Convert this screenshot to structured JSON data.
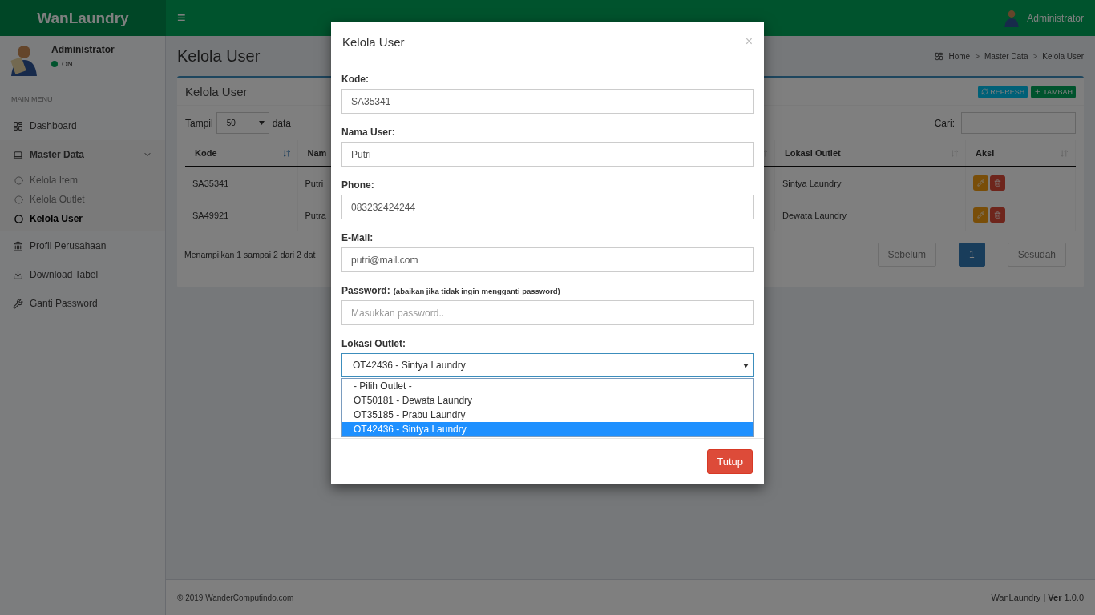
{
  "brand": "WanLaundry",
  "menu_toggle": "≡",
  "user_menu": {
    "name": "Administrator"
  },
  "sidebar": {
    "user": {
      "name": "Administrator",
      "status": "ON",
      "online": true
    },
    "header": "MAIN MENU",
    "items": [
      {
        "label": "Dashboard",
        "kind": "dashboard",
        "selected": false
      },
      {
        "label": "Master Data",
        "kind": "laptop",
        "selected": false,
        "expanded": true,
        "children": [
          {
            "label": "Kelola Item",
            "selected": false
          },
          {
            "label": "Kelola Outlet",
            "selected": false
          },
          {
            "label": "Kelola User",
            "selected": true
          }
        ]
      },
      {
        "label": "Profil Perusahaan",
        "kind": "bank",
        "selected": false
      },
      {
        "label": "Download Tabel",
        "kind": "download",
        "selected": false
      },
      {
        "label": "Ganti Password",
        "kind": "wrench",
        "selected": false
      }
    ]
  },
  "page_title": "Kelola User",
  "breadcrumb": [
    {
      "label": "Home"
    },
    {
      "separator": ">",
      "label": "Master Data"
    },
    {
      "separator": ">",
      "label": "Kelola User"
    }
  ],
  "box": {
    "title": "Kelola User",
    "buttons": [
      {
        "label": "REFRESH",
        "kind": "refresh"
      },
      {
        "label": "TAMBAH",
        "kind": "add"
      }
    ],
    "length": {
      "before": "Tampil",
      "value": "50",
      "after": "data"
    },
    "search": {
      "label": "Cari:"
    },
    "table": {
      "columns": [
        {
          "label": "Kode",
          "sorted": true
        },
        {
          "label": "Nam",
          "sorted": false
        },
        {
          "label": "Lokasi Outlet",
          "sorted": false
        },
        {
          "label": "Aksi",
          "sorted": false
        }
      ],
      "rows": [
        {
          "kode": "SA35341",
          "name": "Putri",
          "outlet": "Sintya Laundry"
        },
        {
          "kode": "SA49921",
          "name": "Putra",
          "outlet": "Dewata Laundry"
        }
      ]
    },
    "info": "Menampilkan 1 sampai 2 dari 2 dat",
    "pagination": [
      {
        "label": "Sebelum",
        "selected": false
      },
      {
        "label": "1",
        "selected": true
      },
      {
        "label": "Sesudah",
        "selected": false
      }
    ]
  },
  "footer": {
    "copyright": "© 2019  WanderComputindo.com",
    "app": "WanLaundry",
    "separator": "|",
    "version_label": "Ver",
    "version": "1.0.0"
  },
  "modal": {
    "title": "Kelola User",
    "close": "×",
    "fields": [
      {
        "label": "Kode:",
        "value": "SA35341"
      },
      {
        "label": "Nama User:",
        "value": "Putri"
      },
      {
        "label": "Phone:",
        "value": "083232424244"
      },
      {
        "label": "E-Mail:",
        "value": "putri@mail.com"
      },
      {
        "label": "Password:",
        "note": "(abaikan jika tidak ingin mengganti password)",
        "placeholder": "Masukkan password.."
      }
    ],
    "select": {
      "label": "Lokasi Outlet:",
      "value": "OT42436 - Sintya Laundry",
      "open": true,
      "options": [
        {
          "label": "- Pilih Outlet -",
          "selected": false
        },
        {
          "label": "OT50181 - Dewata Laundry",
          "selected": false
        },
        {
          "label": "OT35185 - Prabu Laundry",
          "selected": false
        },
        {
          "label": "OT42436 - Sintya Laundry",
          "selected": true
        }
      ]
    },
    "buttons": [
      {
        "label": "Tutup",
        "kind": "danger"
      }
    ]
  }
}
